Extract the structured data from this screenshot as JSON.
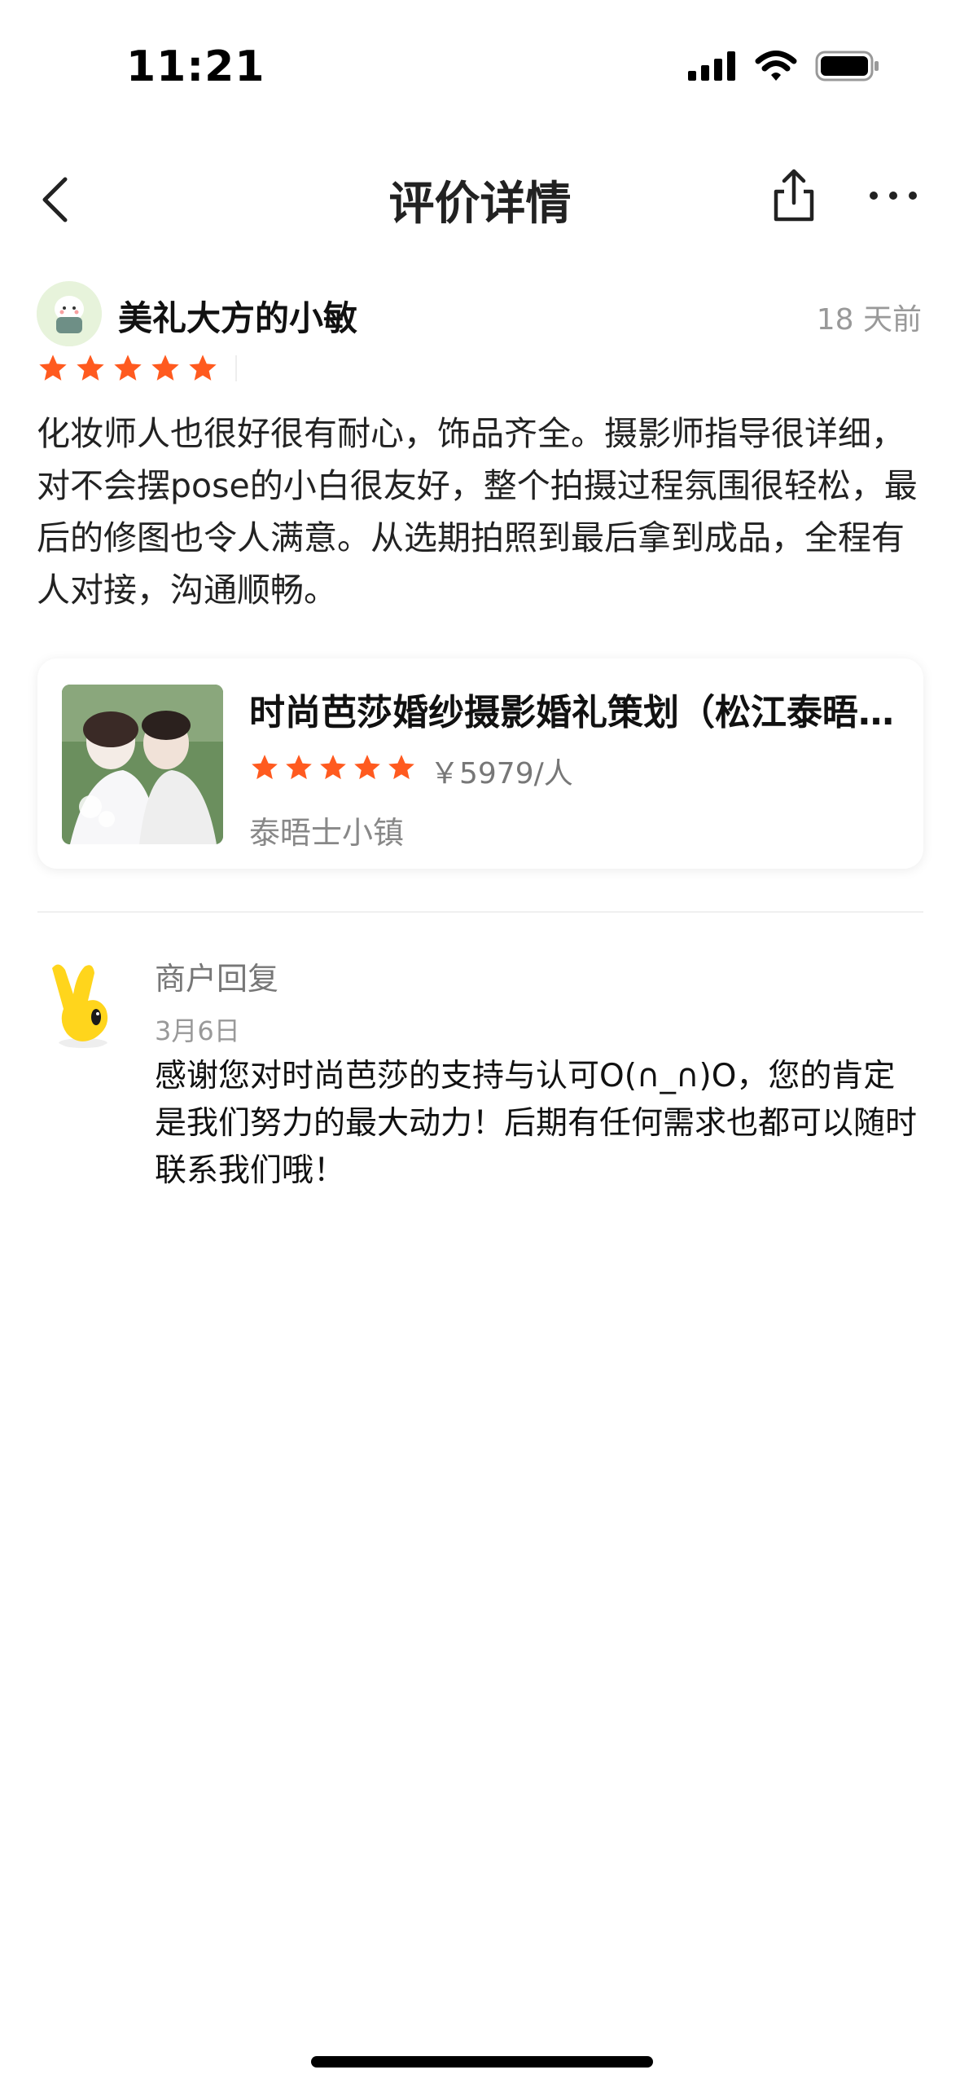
{
  "status_bar": {
    "time": "11:21"
  },
  "nav": {
    "title": "评价详情"
  },
  "review": {
    "username": "美礼大方的小敏",
    "time_ago": "18 天前",
    "rating": 5,
    "text": "化妆师人也很好很有耐心，饰品齐全。摄影师指导很详细，对不会摆pose的小白很友好，整个拍摄过程氛围很轻松，最后的修图也令人满意。从选期拍照到最后拿到成品，全程有人对接，沟通顺畅。"
  },
  "product": {
    "title": "时尚芭莎婚纱摄影婚礼策划（松江泰晤士小镇店）",
    "rating": 5,
    "price": "￥5979/人",
    "location": "泰晤士小镇"
  },
  "reply": {
    "label": "商户回复",
    "date": "3月6日",
    "text": "感谢您对时尚芭莎的支持与认可O(∩_∩)O，您的肯定是我们努力的最大动力！后期有任何需求也都可以随时联系我们哦！"
  },
  "colors": {
    "star": "#ff5a1f",
    "accent": "#ff6a00"
  },
  "icons": [
    "back-icon",
    "share-icon",
    "more-icon",
    "signal-icon",
    "wifi-icon",
    "battery-icon",
    "star-icon"
  ]
}
